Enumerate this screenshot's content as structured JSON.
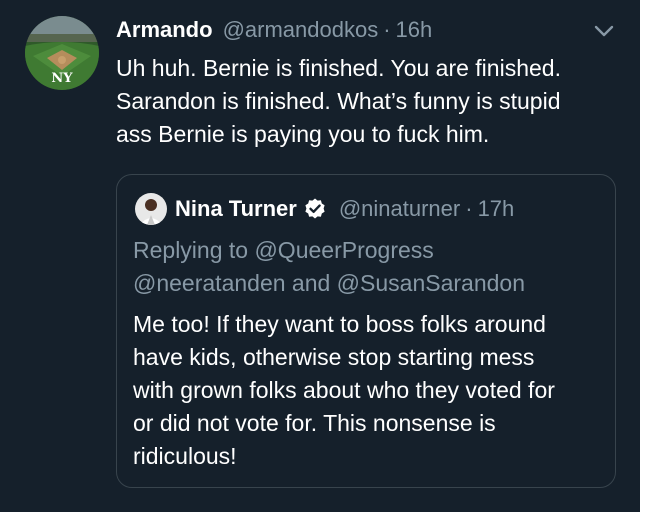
{
  "tweet": {
    "display_name": "Armando",
    "handle": "@armandodkos",
    "separator": "·",
    "time": "16h",
    "text_lines": [
      "Uh huh. Bernie is finished. You are finished.",
      "Sarandon is finished. What’s funny is stupid",
      "ass Bernie is paying you to fuck him."
    ],
    "avatar_icon": "yankees-stadium-avatar",
    "menu_icon": "chevron-down-icon"
  },
  "quoted_tweet": {
    "display_name": "Nina Turner",
    "handle": "@ninaturner",
    "separator": "·",
    "time": "17h",
    "verified_icon": "verified-badge-icon",
    "replying_lines": [
      "Replying to @QueerProgress",
      "@neeratanden and @SusanSarandon"
    ],
    "text_lines": [
      "Me too! If they want to boss folks around",
      "have kids, otherwise stop starting mess",
      "with grown folks about who they voted for",
      "or did not vote for. This nonsense is",
      "ridiculous!"
    ]
  },
  "colors": {
    "background": "#15202b",
    "primary_text": "#ffffff",
    "secondary_text": "#8899a6",
    "border": "#38444d"
  }
}
